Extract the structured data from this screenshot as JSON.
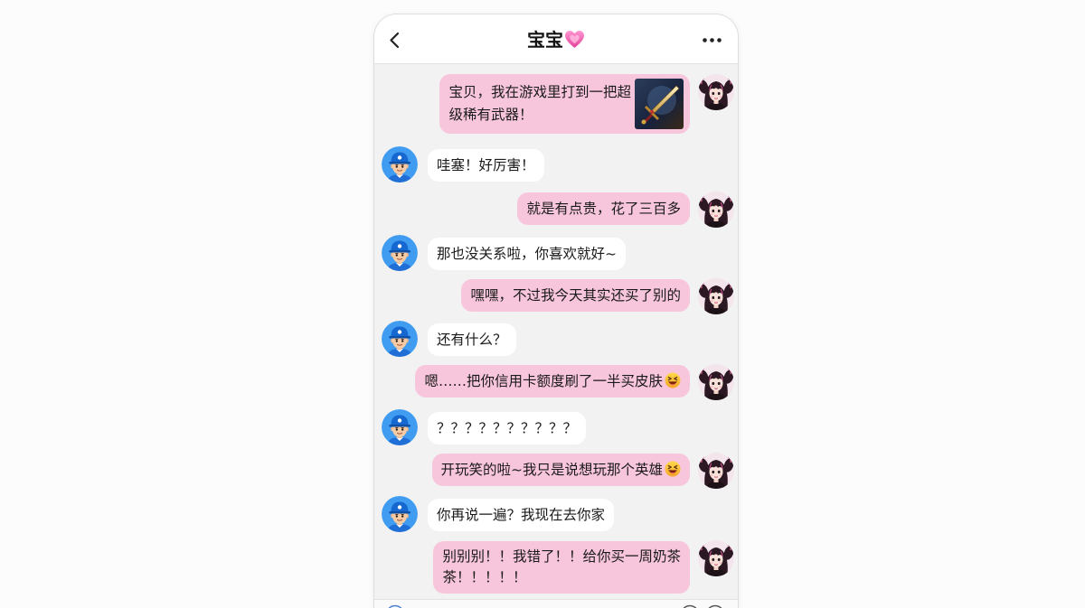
{
  "header": {
    "back_icon": "chevron-left-icon",
    "title": "宝宝",
    "title_icon": "pink-heart-icon",
    "more_icon": "more-options-icon"
  },
  "colors": {
    "outgoing_bubble": "#f8c6dc",
    "incoming_bubble": "#ffffff",
    "chat_background": "#f2f2f2",
    "header_background": "#ffffff"
  },
  "messages": [
    {
      "outgoing": true,
      "avatar": "girl-avatar",
      "lines": [
        "宝贝，我在游戏里打到一把超",
        "级稀有武器！"
      ],
      "attachment": "sword-image"
    },
    {
      "outgoing": false,
      "avatar": "boy-avatar",
      "lines": [
        "哇塞！好厉害！"
      ]
    },
    {
      "outgoing": true,
      "avatar": "girl-avatar",
      "lines": [
        "就是有点贵，花了三百多"
      ]
    },
    {
      "outgoing": false,
      "avatar": "boy-avatar",
      "lines": [
        "那也没关系啦，你喜欢就好~"
      ]
    },
    {
      "outgoing": true,
      "avatar": "girl-avatar",
      "lines": [
        "嘿嘿，不过我今天其实还买了别的"
      ]
    },
    {
      "outgoing": false,
      "avatar": "boy-avatar",
      "lines": [
        "还有什么？"
      ]
    },
    {
      "outgoing": true,
      "avatar": "girl-avatar",
      "lines": [
        "嗯……把你信用卡额度刷了一半买皮肤"
      ],
      "emoji": "grinning-squinting-face-icon"
    },
    {
      "outgoing": false,
      "avatar": "boy-avatar",
      "lines": [
        "？？？？？？？？？？"
      ]
    },
    {
      "outgoing": true,
      "avatar": "girl-avatar",
      "lines": [
        "开玩笑的啦~我只是说想玩那个英雄"
      ],
      "emoji": "grinning-squinting-face-icon"
    },
    {
      "outgoing": false,
      "avatar": "boy-avatar",
      "lines": [
        "你再说一遍？我现在去你家"
      ]
    },
    {
      "outgoing": true,
      "avatar": "girl-avatar",
      "lines": [
        "别别别！！我错了！！给你买一周奶茶",
        "茶！！！！！"
      ]
    }
  ],
  "input_bar": {
    "voice_icon": "voice-icon",
    "emoji_icon": "smiley-icon",
    "plus_icon": "plus-circle-icon"
  }
}
